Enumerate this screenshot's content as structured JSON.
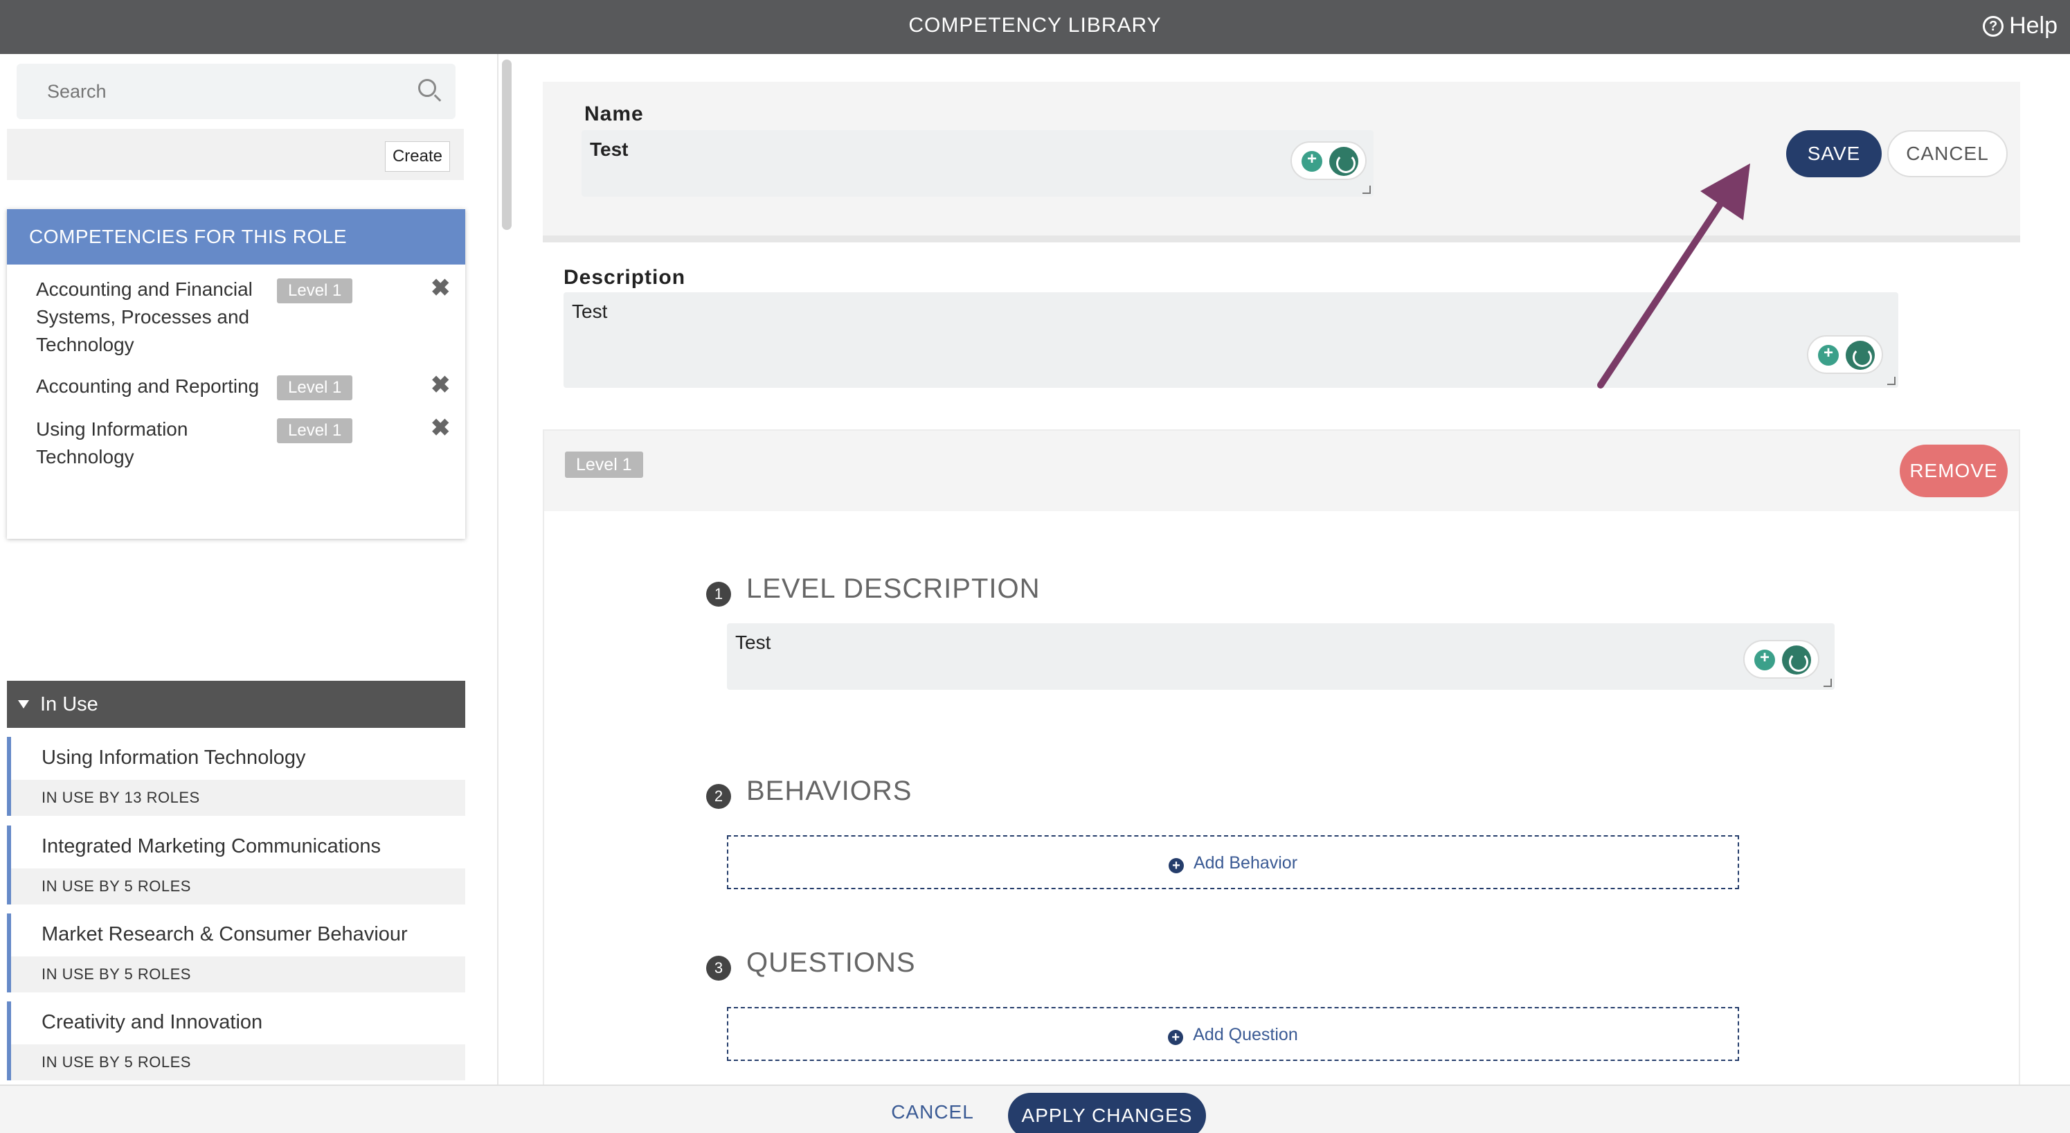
{
  "header": {
    "title": "COMPETENCY LIBRARY",
    "help_label": "Help"
  },
  "sidebar": {
    "search_placeholder": "Search",
    "create_label": "Create",
    "roles_heading": "COMPETENCIES FOR THIS ROLE",
    "role_competencies": [
      {
        "name": "Accounting and Financial Systems, Processes and Technology",
        "level": "Level 1"
      },
      {
        "name": "Accounting and Reporting",
        "level": "Level 1"
      },
      {
        "name": "Using Information Technology",
        "level": "Level 1"
      }
    ],
    "in_use_heading": "In Use",
    "in_use_items": [
      {
        "name": "Using Information Technology",
        "count": "IN USE BY 13 ROLES"
      },
      {
        "name": "Integrated Marketing Communications",
        "count": "IN USE BY 5 ROLES"
      },
      {
        "name": "Market Research & Consumer Behaviour",
        "count": "IN USE BY 5 ROLES"
      },
      {
        "name": "Creativity and Innovation",
        "count": "IN USE BY 5 ROLES"
      }
    ]
  },
  "editor": {
    "name_label": "Name",
    "name_value": "Test",
    "description_label": "Description",
    "description_value": "Test",
    "save_label": "SAVE",
    "cancel_label": "CANCEL",
    "level": {
      "tag": "Level 1",
      "remove_label": "REMOVE",
      "sections": [
        {
          "num": "1",
          "title": "LEVEL DESCRIPTION",
          "value": "Test"
        },
        {
          "num": "2",
          "title": "BEHAVIORS",
          "add_label": "Add Behavior"
        },
        {
          "num": "3",
          "title": "QUESTIONS",
          "add_label": "Add Question"
        }
      ]
    }
  },
  "footer": {
    "cancel_label": "CANCEL",
    "apply_label": "APPLY CHANGES"
  },
  "colors": {
    "accent_navy": "#253d6b",
    "role_blue": "#668ac8",
    "remove_red": "#e57373",
    "arrow": "#7a3b67"
  },
  "icons": [
    "help-circle-icon",
    "search-icon",
    "close-icon",
    "lightbulb-plus-icon",
    "spinner-icon",
    "plus-circle-icon",
    "caret-down-icon"
  ]
}
